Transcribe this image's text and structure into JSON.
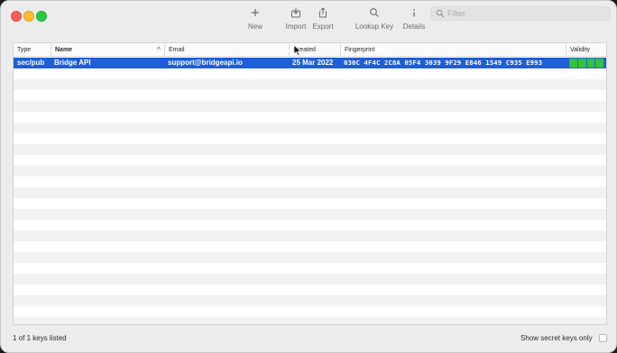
{
  "toolbar": {
    "new_label": "New",
    "import_label": "Import",
    "export_label": "Export",
    "lookup_label": "Lookup Key",
    "details_label": "Details",
    "filter_placeholder": "Filter"
  },
  "table": {
    "headers": {
      "type": "Type",
      "name": "Name",
      "email": "Email",
      "created": "Created",
      "fingerprint": "Fingerprint",
      "validity": "Validity"
    },
    "sort_indicator": "^",
    "rows": [
      {
        "type": "sec/pub",
        "name": "Bridge API",
        "email": "support@bridgeapi.io",
        "created": "25 Mar 2022",
        "fingerprint": "030C 4F4C 2C8A 05F4 3039  9F29 E846 1549 C935 E993",
        "validity_color": "#32c33c",
        "selected": true
      }
    ]
  },
  "footer": {
    "status": "1 of 1 keys listed",
    "secret_label": "Show secret keys only"
  },
  "colors": {
    "selection": "#1e5ed6",
    "validity_good": "#32c33c"
  }
}
